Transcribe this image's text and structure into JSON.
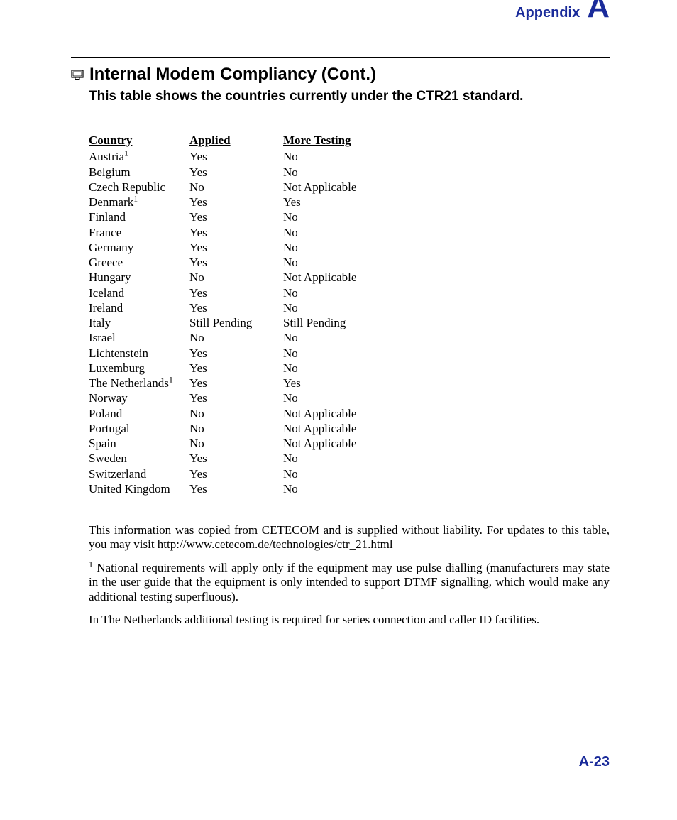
{
  "appendix": {
    "label": "Appendix",
    "letter": "A"
  },
  "title": "Internal Modem Compliancy (Cont.)",
  "subtitle": "This table shows the countries currently under the CTR21 standard.",
  "headers": {
    "country": "Country",
    "applied": "Applied",
    "more": "More Testing"
  },
  "rows": [
    {
      "country": "Austria",
      "sup": "1",
      "applied": "Yes",
      "more": "No"
    },
    {
      "country": "Belgium",
      "sup": "",
      "applied": "Yes",
      "more": "No"
    },
    {
      "country": "Czech Republic",
      "sup": "",
      "applied": "No",
      "more": "Not Applicable"
    },
    {
      "country": "Denmark",
      "sup": "1",
      "applied": "Yes",
      "more": "Yes"
    },
    {
      "country": "Finland",
      "sup": "",
      "applied": "Yes",
      "more": "No"
    },
    {
      "country": "France",
      "sup": "",
      "applied": "Yes",
      "more": "No"
    },
    {
      "country": "Germany",
      "sup": "",
      "applied": "Yes",
      "more": "No"
    },
    {
      "country": "Greece",
      "sup": "",
      "applied": "Yes",
      "more": "No"
    },
    {
      "country": "Hungary",
      "sup": "",
      "applied": "No",
      "more": "Not Applicable"
    },
    {
      "country": "Iceland",
      "sup": "",
      "applied": "Yes",
      "more": "No"
    },
    {
      "country": "Ireland",
      "sup": "",
      "applied": "Yes",
      "more": "No"
    },
    {
      "country": "Italy",
      "sup": "",
      "applied": "Still Pending",
      "more": "Still Pending"
    },
    {
      "country": "Israel",
      "sup": "",
      "applied": "No",
      "more": "No"
    },
    {
      "country": "Lichtenstein",
      "sup": "",
      "applied": "Yes",
      "more": "No"
    },
    {
      "country": "Luxemburg",
      "sup": "",
      "applied": "Yes",
      "more": "No"
    },
    {
      "country": "The Netherlands",
      "sup": "1",
      "applied": "Yes",
      "more": "Yes"
    },
    {
      "country": "Norway",
      "sup": "",
      "applied": "Yes",
      "more": "No"
    },
    {
      "country": "Poland",
      "sup": "",
      "applied": "No",
      "more": "Not Applicable"
    },
    {
      "country": "Portugal",
      "sup": "",
      "applied": "No",
      "more": "Not Applicable"
    },
    {
      "country": "Spain",
      "sup": "",
      "applied": "No",
      "more": "Not Applicable"
    },
    {
      "country": "Sweden",
      "sup": "",
      "applied": "Yes",
      "more": "No"
    },
    {
      "country": "Switzerland",
      "sup": "",
      "applied": "Yes",
      "more": "No"
    },
    {
      "country": "United Kingdom",
      "sup": "",
      "applied": "Yes",
      "more": "No"
    }
  ],
  "para1": "This information was copied from CETECOM and is supplied without liability. For updates to this table, you may visit http://www.cetecom.de/technologies/ctr_21.html",
  "footnote_sup": "1",
  "footnote_text": " National requirements will apply only if the equipment may use pulse dialling (manufacturers may state in the user guide that the equipment is only intended to support DTMF signalling, which would make any additional testing superfluous).",
  "para3": "In The Netherlands additional testing is required for series connection and caller ID facilities.",
  "page_num": "A-23"
}
